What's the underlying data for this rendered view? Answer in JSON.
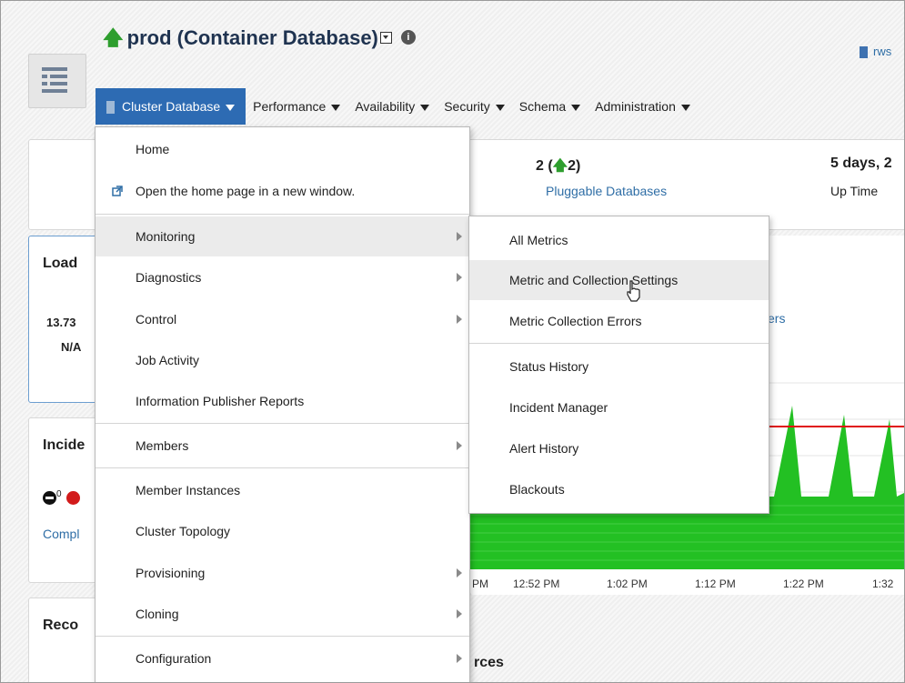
{
  "header": {
    "title": "prod (Container Database)",
    "host": "rws"
  },
  "menubar": [
    {
      "label": "Cluster Database",
      "active": true
    },
    {
      "label": "Performance"
    },
    {
      "label": "Availability"
    },
    {
      "label": "Security"
    },
    {
      "label": "Schema"
    },
    {
      "label": "Administration"
    }
  ],
  "summary": {
    "pluggable_count": "2 (",
    "pluggable_up": "2)",
    "pluggable_label": "Pluggable Databases",
    "uptime": "5 days, 2",
    "uptime_label": "Up Time"
  },
  "load": {
    "title": "Load",
    "value": "13.73",
    "na": "N/A"
  },
  "incidents": {
    "title": "Incide",
    "count": "0",
    "link": "Compl"
  },
  "reco": {
    "title": "Reco"
  },
  "chart_area": {
    "partial_link": "ers",
    "ticks": [
      "PM",
      "12:52 PM",
      "1:02 PM",
      "1:12 PM",
      "1:22 PM",
      "1:32"
    ],
    "resources_heading": "rces"
  },
  "cluster_menu": {
    "items": [
      {
        "label": "Home"
      },
      {
        "label": "Open the home page in a new window.",
        "icon": "new-window-icon"
      },
      {
        "label": "Monitoring",
        "submenu": true,
        "highlighted": true
      },
      {
        "label": "Diagnostics",
        "submenu": true
      },
      {
        "label": "Control",
        "submenu": true
      },
      {
        "label": "Job Activity"
      },
      {
        "label": "Information Publisher Reports"
      },
      {
        "label": "Members",
        "submenu": true
      },
      {
        "label": "Member Instances"
      },
      {
        "label": "Cluster Topology"
      },
      {
        "label": "Provisioning",
        "submenu": true
      },
      {
        "label": "Cloning",
        "submenu": true
      },
      {
        "label": "Configuration",
        "submenu": true
      }
    ]
  },
  "monitoring_menu": {
    "items": [
      {
        "label": "All Metrics"
      },
      {
        "label": "Metric and Collection Settings",
        "highlighted": true
      },
      {
        "label": "Metric Collection Errors"
      },
      {
        "label": "Status History"
      },
      {
        "label": "Incident Manager"
      },
      {
        "label": "Alert History"
      },
      {
        "label": "Blackouts"
      }
    ]
  },
  "colors": {
    "menubar_active": "#2d6bb3",
    "link": "#2f6ea6",
    "up_arrow": "#2e9e2e",
    "chart_fill": "#23c023",
    "threshold": "#e01010"
  }
}
